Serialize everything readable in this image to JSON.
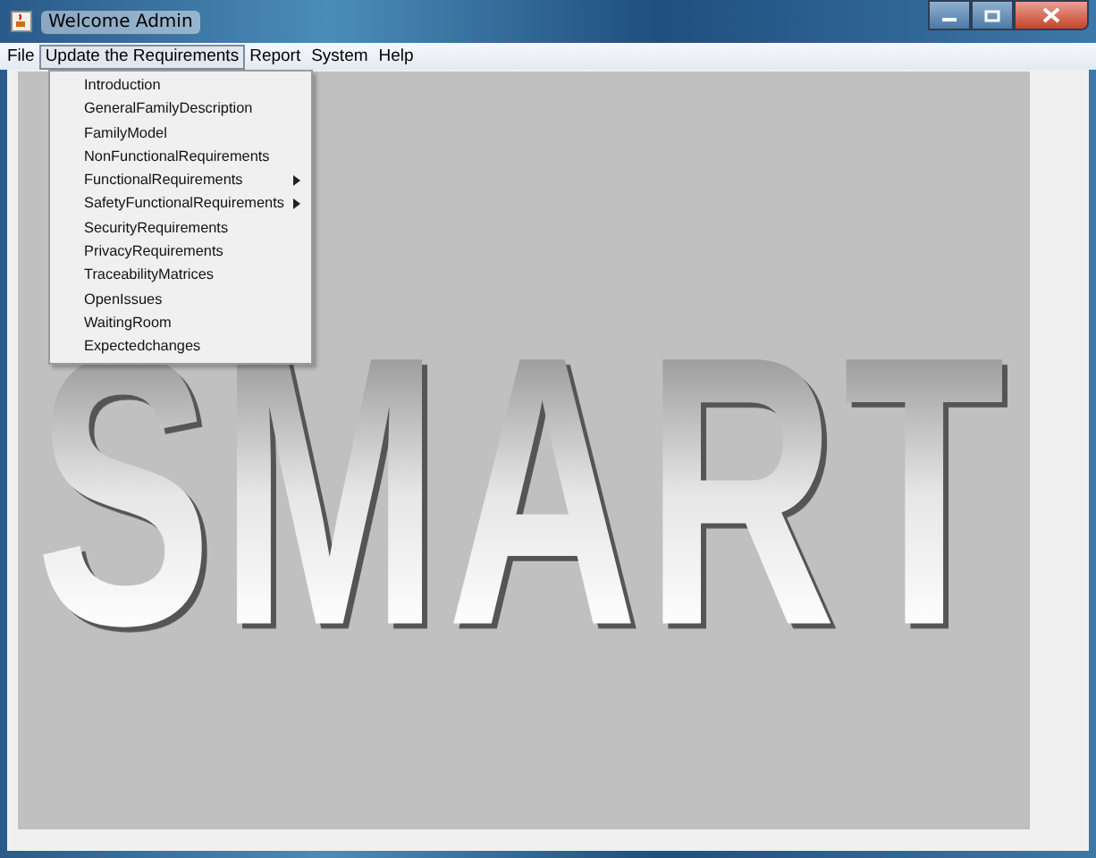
{
  "window": {
    "title": "Welcome Admin"
  },
  "menu_bar": [
    {
      "label": "File",
      "selected": false
    },
    {
      "label": "Update the Requirements",
      "selected": true
    },
    {
      "label": "Report",
      "selected": false
    },
    {
      "label": "System",
      "selected": false
    },
    {
      "label": "Help",
      "selected": false
    }
  ],
  "dropdown": [
    {
      "label": "Introduction",
      "submenu": false
    },
    {
      "label": "GeneralFamilyDescription",
      "submenu": false
    },
    {
      "label": "FamilyModel",
      "submenu": false
    },
    {
      "label": "NonFunctionalRequirements",
      "submenu": false
    },
    {
      "label": "FunctionalRequirements",
      "submenu": true
    },
    {
      "label": "SafetyFunctionalRequirements",
      "submenu": true
    },
    {
      "label": "SecurityRequirements",
      "submenu": false
    },
    {
      "label": "PrivacyRequirements",
      "submenu": false
    },
    {
      "label": "TraceabilityMatrices",
      "submenu": false
    },
    {
      "label": "OpenIssues",
      "submenu": false
    },
    {
      "label": "WaitingRoom",
      "submenu": false
    },
    {
      "label": "Expectedchanges",
      "submenu": false
    }
  ],
  "logo": {
    "text": "SMART"
  }
}
